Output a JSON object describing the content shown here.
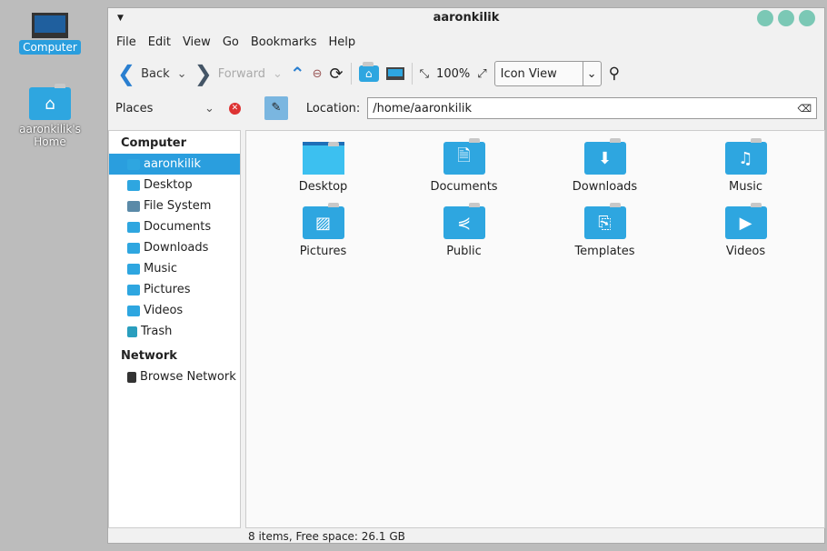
{
  "desktop": [
    {
      "label": "Computer"
    },
    {
      "label": "aaronkilik's Home"
    }
  ],
  "window": {
    "title": "aaronkilik"
  },
  "menu": [
    "File",
    "Edit",
    "View",
    "Go",
    "Bookmarks",
    "Help"
  ],
  "toolbar": {
    "back": "Back",
    "forward": "Forward",
    "zoom": "100%",
    "view": "Icon View"
  },
  "location": {
    "places": "Places",
    "label": "Location:",
    "path": "/home/aaronkilik"
  },
  "sidebar": {
    "computer_header": "Computer",
    "computer": [
      "aaronkilik",
      "Desktop",
      "File System",
      "Documents",
      "Downloads",
      "Music",
      "Pictures",
      "Videos",
      "Trash"
    ],
    "network_header": "Network",
    "network": [
      "Browse Network"
    ]
  },
  "files": [
    {
      "name": "Desktop",
      "icon": "desktop"
    },
    {
      "name": "Documents",
      "icon": "document"
    },
    {
      "name": "Downloads",
      "icon": "download"
    },
    {
      "name": "Music",
      "icon": "music-note"
    },
    {
      "name": "Pictures",
      "icon": "picture"
    },
    {
      "name": "Public",
      "icon": "share"
    },
    {
      "name": "Templates",
      "icon": "template"
    },
    {
      "name": "Videos",
      "icon": "film"
    }
  ],
  "status": "8 items, Free space: 26.1 GB",
  "colors": {
    "accent": "#2a9ede",
    "folder": "#2ea6e0"
  }
}
